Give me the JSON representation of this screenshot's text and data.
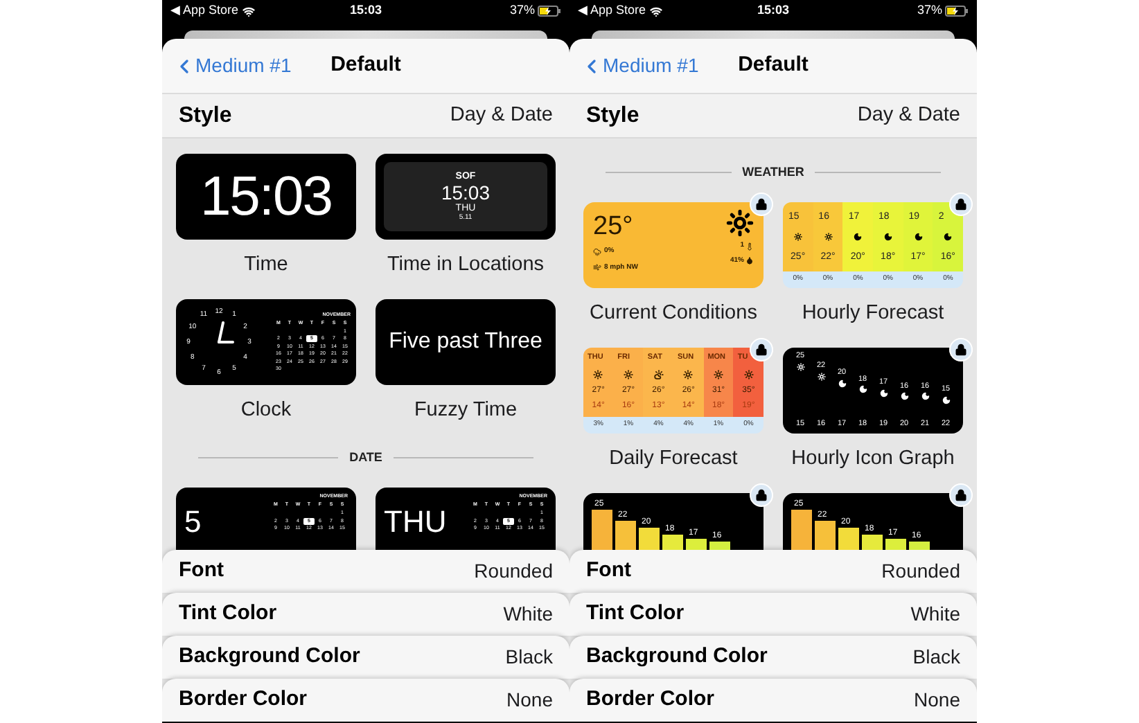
{
  "phones": [
    {
      "status": {
        "back_app": "◀ App Store",
        "time": "15:03",
        "battery": "37%"
      },
      "nav": {
        "back": "Medium #1",
        "title": "Default"
      },
      "style_row": {
        "label": "Style",
        "value": "Day & Date"
      },
      "sections": [
        {
          "widgets": [
            {
              "kind": "big-time",
              "label": "Time",
              "locked": false,
              "text": "15:03"
            },
            {
              "kind": "locations",
              "label": "Time in Locations",
              "locked": false,
              "city": "SOF",
              "time": "15:03",
              "day": "THU",
              "date": "5.11"
            },
            {
              "kind": "clock-calendar",
              "label": "Clock",
              "locked": false,
              "dial": [
                "12",
                "1",
                "2",
                "3",
                "4",
                "5",
                "6",
                "7",
                "8",
                "9",
                "10",
                "11"
              ],
              "calendar": {
                "month": "NOVEMBER",
                "weekdays": [
                  "M",
                  "T",
                  "W",
                  "T",
                  "F",
                  "S",
                  "S"
                ],
                "weeks": [
                  [
                    {
                      "d": "1",
                      "selected": false
                    }
                  ],
                  [
                    {
                      "d": "2",
                      "selected": false
                    },
                    {
                      "d": "3",
                      "selected": false
                    },
                    {
                      "d": "4",
                      "selected": false
                    },
                    {
                      "d": "5",
                      "selected": true
                    },
                    {
                      "d": "6",
                      "selected": false
                    },
                    {
                      "d": "7",
                      "selected": false
                    },
                    {
                      "d": "8",
                      "selected": false
                    }
                  ],
                  [
                    {
                      "d": "9",
                      "selected": false
                    },
                    {
                      "d": "10",
                      "selected": false
                    },
                    {
                      "d": "11",
                      "selected": false
                    },
                    {
                      "d": "12",
                      "selected": false
                    },
                    {
                      "d": "13",
                      "selected": false
                    },
                    {
                      "d": "14",
                      "selected": false
                    },
                    {
                      "d": "15",
                      "selected": false
                    }
                  ],
                  [
                    {
                      "d": "16",
                      "selected": false
                    },
                    {
                      "d": "17",
                      "selected": false
                    },
                    {
                      "d": "18",
                      "selected": false
                    },
                    {
                      "d": "19",
                      "selected": false
                    },
                    {
                      "d": "20",
                      "selected": false
                    },
                    {
                      "d": "21",
                      "selected": false
                    },
                    {
                      "d": "22",
                      "selected": false
                    }
                  ],
                  [
                    {
                      "d": "23",
                      "selected": false
                    },
                    {
                      "d": "24",
                      "selected": false
                    },
                    {
                      "d": "25",
                      "selected": false
                    },
                    {
                      "d": "26",
                      "selected": false
                    },
                    {
                      "d": "27",
                      "selected": false
                    },
                    {
                      "d": "28",
                      "selected": false
                    },
                    {
                      "d": "29",
                      "selected": false
                    }
                  ],
                  [
                    {
                      "d": "30",
                      "selected": false
                    }
                  ]
                ]
              }
            },
            {
              "kind": "fuzzy",
              "label": "Fuzzy Time",
              "locked": false,
              "text": "Five past Three"
            }
          ]
        },
        {
          "header": "DATE",
          "widgets": [
            {
              "kind": "big-day",
              "locked": false,
              "text": "5",
              "calendar": {
                "month": "NOVEMBER",
                "weekdays": [
                  "M",
                  "T",
                  "W",
                  "T",
                  "F",
                  "S",
                  "S"
                ],
                "weeks": [
                  [
                    {
                      "d": "1",
                      "selected": false
                    }
                  ],
                  [
                    {
                      "d": "2",
                      "selected": false
                    },
                    {
                      "d": "3",
                      "selected": false
                    },
                    {
                      "d": "4",
                      "selected": false
                    },
                    {
                      "d": "5",
                      "selected": true
                    },
                    {
                      "d": "6",
                      "selected": false
                    },
                    {
                      "d": "7",
                      "selected": false
                    },
                    {
                      "d": "8",
                      "selected": false
                    }
                  ],
                  [
                    {
                      "d": "9",
                      "selected": false
                    },
                    {
                      "d": "10",
                      "selected": false
                    },
                    {
                      "d": "11",
                      "selected": false
                    },
                    {
                      "d": "12",
                      "selected": false
                    },
                    {
                      "d": "13",
                      "selected": false
                    },
                    {
                      "d": "14",
                      "selected": false
                    },
                    {
                      "d": "15",
                      "selected": false
                    }
                  ]
                ]
              }
            },
            {
              "kind": "big-day",
              "locked": false,
              "text": "THU",
              "calendar": {
                "month": "NOVEMBER",
                "weekdays": [
                  "M",
                  "T",
                  "W",
                  "T",
                  "F",
                  "S",
                  "S"
                ],
                "weeks": [
                  [
                    {
                      "d": "1",
                      "selected": false
                    }
                  ],
                  [
                    {
                      "d": "2",
                      "selected": false
                    },
                    {
                      "d": "3",
                      "selected": false
                    },
                    {
                      "d": "4",
                      "selected": false
                    },
                    {
                      "d": "5",
                      "selected": true
                    },
                    {
                      "d": "6",
                      "selected": false
                    },
                    {
                      "d": "7",
                      "selected": false
                    },
                    {
                      "d": "8",
                      "selected": false
                    }
                  ],
                  [
                    {
                      "d": "9",
                      "selected": false
                    },
                    {
                      "d": "10",
                      "selected": false
                    },
                    {
                      "d": "11",
                      "selected": false
                    },
                    {
                      "d": "12",
                      "selected": false
                    },
                    {
                      "d": "13",
                      "selected": false
                    },
                    {
                      "d": "14",
                      "selected": false
                    },
                    {
                      "d": "15",
                      "selected": false
                    }
                  ]
                ]
              }
            }
          ]
        }
      ],
      "settings": [
        {
          "label": "Font",
          "value": "Rounded"
        },
        {
          "label": "Tint Color",
          "value": "White"
        },
        {
          "label": "Background Color",
          "value": "Black"
        },
        {
          "label": "Border Color",
          "value": "None"
        }
      ]
    },
    {
      "status": {
        "back_app": "◀ App Store",
        "time": "15:03",
        "battery": "37%"
      },
      "nav": {
        "back": "Medium #1",
        "title": "Default"
      },
      "style_row": {
        "label": "Style",
        "value": "Day & Date"
      },
      "sections": [
        {
          "header": "WEATHER",
          "widgets": [
            {
              "kind": "current",
              "label": "Current Conditions",
              "locked": true,
              "temp": "25°",
              "rain": "0%",
              "wind": "8 mph NW",
              "uv": "1",
              "humidity": "41%"
            },
            {
              "kind": "hourly",
              "label": "Hourly Forecast",
              "locked": true,
              "columns": [
                {
                  "hour": "15",
                  "kind": "day",
                  "temp": "25°",
                  "rain": "0%",
                  "color": "#f8c23a"
                },
                {
                  "hour": "16",
                  "kind": "day",
                  "temp": "22°",
                  "rain": "0%",
                  "color": "#f8c83a"
                },
                {
                  "hour": "17",
                  "kind": "night",
                  "temp": "20°",
                  "rain": "0%",
                  "color": "#f0f23a"
                },
                {
                  "hour": "18",
                  "kind": "night",
                  "temp": "18°",
                  "rain": "0%",
                  "color": "#e8f43a"
                },
                {
                  "hour": "19",
                  "kind": "night",
                  "temp": "17°",
                  "rain": "0%",
                  "color": "#e0f43a"
                },
                {
                  "hour": "2",
                  "kind": "night",
                  "temp": "16°",
                  "rain": "0%",
                  "color": "#d8f43c"
                }
              ]
            },
            {
              "kind": "daily",
              "label": "Daily Forecast",
              "locked": true,
              "columns": [
                {
                  "day": "THU",
                  "kind": "day",
                  "high": "27°",
                  "low": "14°",
                  "rain": "3%",
                  "color": "#fbb04a"
                },
                {
                  "day": "FRI",
                  "kind": "day",
                  "high": "27°",
                  "low": "16°",
                  "rain": "1%",
                  "color": "#fbb04a"
                },
                {
                  "day": "SAT",
                  "kind": "cloudy",
                  "high": "26°",
                  "low": "13°",
                  "rain": "4%",
                  "color": "#fbb64c"
                },
                {
                  "day": "SUN",
                  "kind": "day",
                  "high": "26°",
                  "low": "14°",
                  "rain": "4%",
                  "color": "#fbb64c"
                },
                {
                  "day": "MON",
                  "kind": "day",
                  "high": "31°",
                  "low": "18°",
                  "rain": "1%",
                  "color": "#f7864a"
                },
                {
                  "day": "TU",
                  "kind": "day",
                  "high": "35°",
                  "low": "19°",
                  "rain": "0%",
                  "color": "#f2603e"
                }
              ]
            },
            {
              "kind": "icon-graph",
              "label": "Hourly Icon Graph",
              "locked": true,
              "points": [
                {
                  "temp": "25",
                  "hour": "15",
                  "kind": "day"
                },
                {
                  "temp": "22",
                  "hour": "16",
                  "kind": "day"
                },
                {
                  "temp": "20",
                  "hour": "17",
                  "kind": "night"
                },
                {
                  "temp": "18",
                  "hour": "18",
                  "kind": "night"
                },
                {
                  "temp": "17",
                  "hour": "19",
                  "kind": "night"
                },
                {
                  "temp": "16",
                  "hour": "20",
                  "kind": "night"
                },
                {
                  "temp": "16",
                  "hour": "21",
                  "kind": "night"
                },
                {
                  "temp": "15",
                  "hour": "22",
                  "kind": "night"
                }
              ]
            },
            {
              "kind": "bars",
              "locked": true,
              "bars": [
                "25",
                "22",
                "20",
                "18",
                "17",
                "16"
              ]
            },
            {
              "kind": "bars",
              "locked": true,
              "bars": [
                "25",
                "22",
                "20",
                "18",
                "17",
                "16"
              ]
            }
          ]
        }
      ],
      "settings": [
        {
          "label": "Font",
          "value": "Rounded"
        },
        {
          "label": "Tint Color",
          "value": "White"
        },
        {
          "label": "Background Color",
          "value": "Black"
        },
        {
          "label": "Border Color",
          "value": "None"
        }
      ]
    }
  ]
}
